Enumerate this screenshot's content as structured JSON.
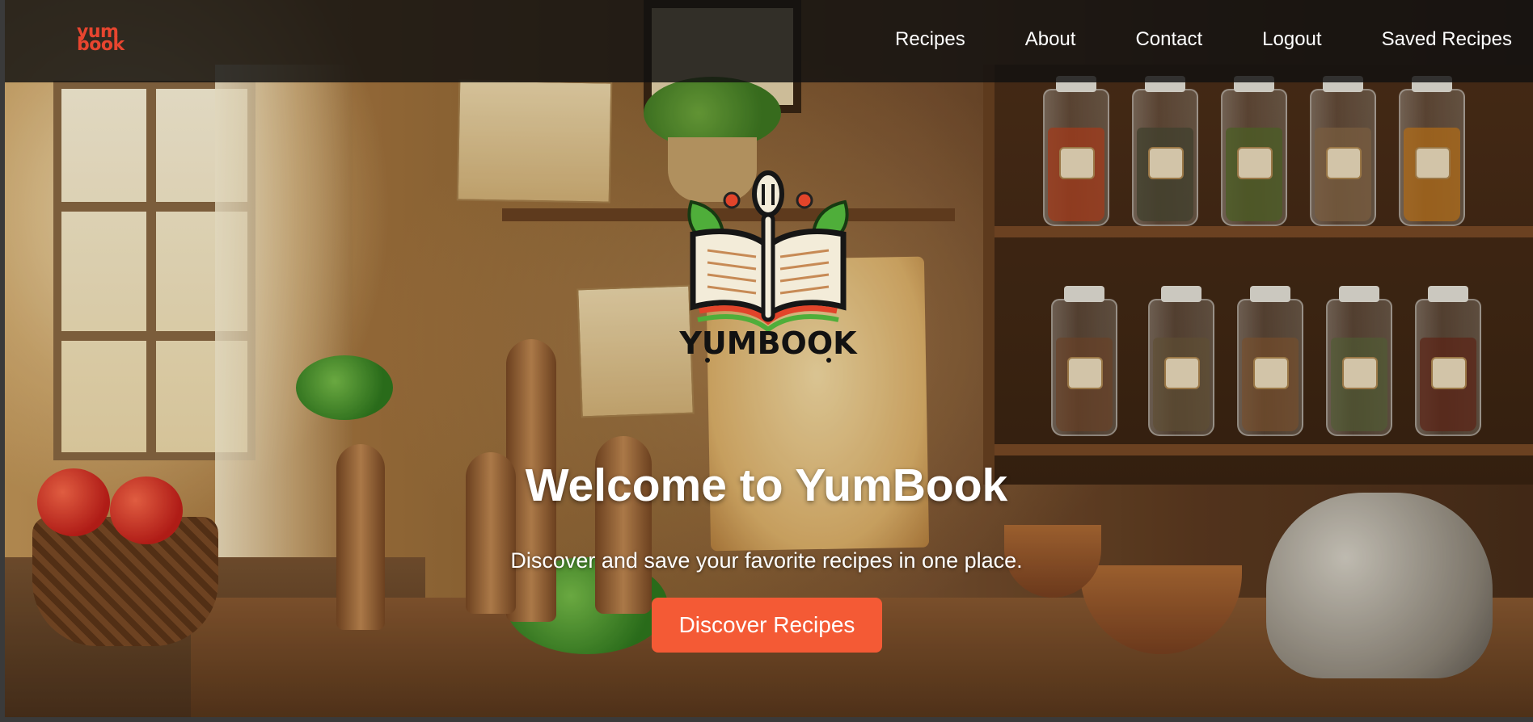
{
  "brand": {
    "line1": "yum",
    "line2": "book",
    "color": "#e8452f"
  },
  "nav": {
    "items": [
      {
        "label": "Recipes"
      },
      {
        "label": "About"
      },
      {
        "label": "Contact"
      },
      {
        "label": "Logout"
      },
      {
        "label": "Saved Recipes"
      }
    ]
  },
  "hero": {
    "logo_text": "YUMBOOK",
    "title": "Welcome to YumBook",
    "subtitle": "Discover and save your favorite recipes in one place.",
    "cta_label": "Discover Recipes",
    "cta_color": "#f45a35",
    "background": "rustic kitchen with spice jars, window, herbs and teapot"
  },
  "icons": [
    "book-spoon-logo-icon"
  ]
}
